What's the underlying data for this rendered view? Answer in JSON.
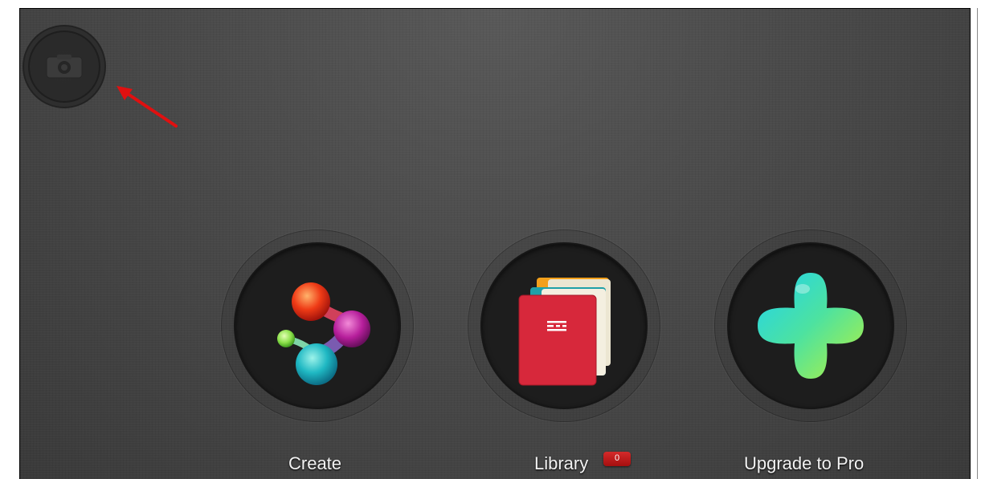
{
  "home": {
    "camera_button": {
      "icon": "camera-icon"
    },
    "annotation": {
      "icon": "red-arrow-icon",
      "color": "#e01010"
    },
    "actions": [
      {
        "label": "Create",
        "icon": "molecule-icon"
      },
      {
        "label": "Library",
        "icon": "folders-icon",
        "badge": "0"
      },
      {
        "label": "Upgrade to Pro",
        "icon": "plus-icon"
      }
    ]
  },
  "colors": {
    "background": "#4a4a4a",
    "circle_inner": "#1d1d1d",
    "badge": "#c01818",
    "label": "#f2f2f2"
  }
}
